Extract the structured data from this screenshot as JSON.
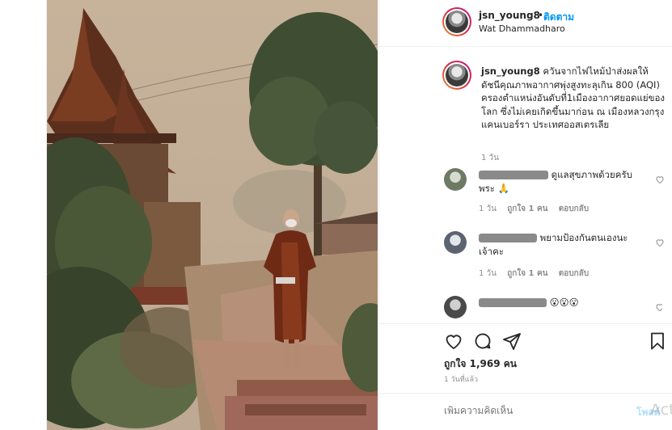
{
  "post": {
    "username": "jsn_young8",
    "separator": "•",
    "follow_label": "ติดตาม",
    "location": "Wat Dhammadharo"
  },
  "caption": {
    "username": "jsn_young8",
    "text": "ควันจากไฟไหม้ป่าส่งผลให้ดัชนีคุณภาพอากาศพุ่งสูงทะลุเกิน 800 (AQI) ครองตำแหน่งอันดับที่1เมืองอากาศยอดแย่ของโลก ซึ่งไม่เคยเกิดขึ้นมาก่อน ณ เมืองหลวงกรุงแคนเบอร์รา ประเทศออสเตรเลีย",
    "time": "1 วัน"
  },
  "comments": [
    {
      "text": "ดูแลสุขภาพด้วยครับพระ 🙏",
      "time": "1 วัน",
      "likes": "ถูกใจ 1 คน",
      "reply": "ตอบกลับ"
    },
    {
      "text": "พยามป้องกันตนเองนะเจ้าคะ",
      "time": "1 วัน",
      "likes": "ถูกใจ 1 คน",
      "reply": "ตอบกลับ"
    },
    {
      "text": "😮😮😮",
      "time": "",
      "likes": "",
      "reply": ""
    }
  ],
  "likes_label": "ถูกใจ 1,969 คน",
  "posted_time": "1 วันที่แล้ว",
  "add_comment": {
    "placeholder": "เพิ่มความคิดเห็น",
    "post_label": "โพสต์"
  },
  "watermark": "Act",
  "icons": {
    "like": "heart-icon",
    "comment": "comment-icon",
    "share": "share-icon",
    "save": "bookmark-icon"
  },
  "colors": {
    "link_blue": "#0095f6",
    "muted": "#8e8e8e",
    "story_ring": "#dc2743"
  }
}
